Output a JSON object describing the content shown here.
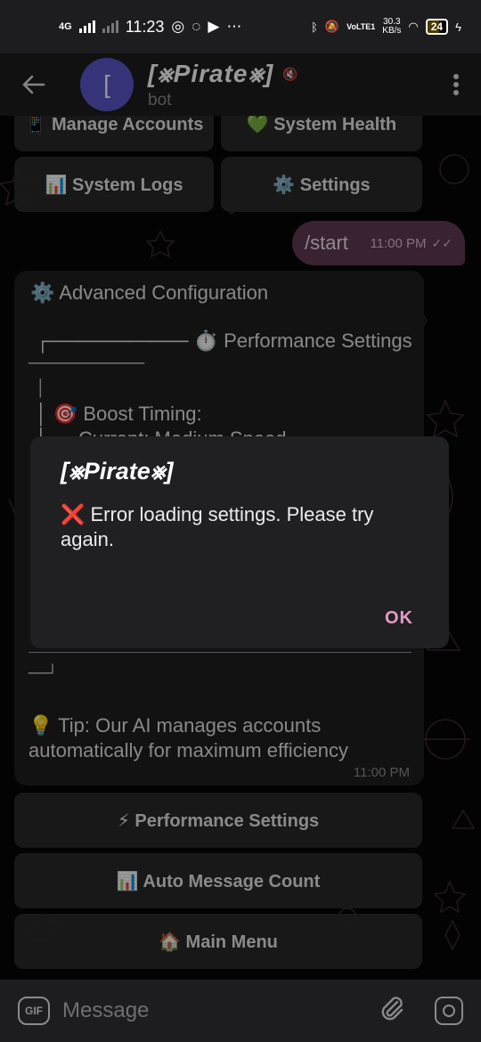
{
  "status_bar": {
    "network": "4G",
    "time": "11:23",
    "speed_value": "30.3",
    "speed_unit": "KB/s",
    "volte": "VoLTE1",
    "battery": "24"
  },
  "header": {
    "back_icon": "arrow-left-icon",
    "avatar_letter": "[",
    "title": "[⨳Pirate⨳]",
    "subtitle": "bot"
  },
  "top_keyboard": {
    "manage_accounts": "📱 Manage Accounts",
    "system_health": "💚 System Health",
    "system_logs": "📊 System Logs",
    "settings": "⚙️ Settings"
  },
  "outgoing": {
    "text": "/start",
    "time": "11:00 PM",
    "ticks": "✓✓"
  },
  "incoming": {
    "heading": "⚙️ Advanced Configuration",
    "perf_line": "┌────────── ⏱️ Performance Settings",
    "box_top": "────────────",
    "pipe1": "│",
    "boost": "│  🎯 Boost Timing:",
    "current": "│  → Current: Medium Speed",
    "box_bottom": "──┘",
    "tip": "💡 Tip: Our AI manages accounts",
    "tip2": "automatically for maximum efficiency",
    "time": "11:00 PM"
  },
  "dialog": {
    "title": "[⨳Pirate⨳]",
    "message": "❌ Error loading settings. Please try again.",
    "ok": "OK"
  },
  "bottom_keyboard": {
    "performance": "⚡ Performance Settings",
    "auto_message": "📊 Auto Message Count",
    "main_menu": "🏠 Main Menu"
  },
  "composer": {
    "gif": "GIF",
    "placeholder": "Message"
  },
  "colors": {
    "avatar": "#5a56c9",
    "outgoing_bubble": "#5f3a53",
    "accent": "#e89ac4"
  }
}
